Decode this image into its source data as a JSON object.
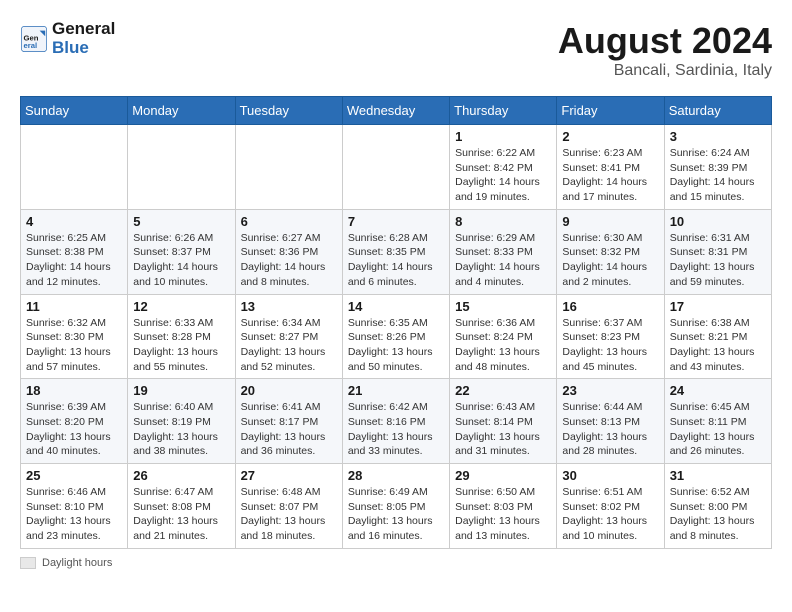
{
  "header": {
    "logo_line1": "General",
    "logo_line2": "Blue",
    "month_year": "August 2024",
    "location": "Bancali, Sardinia, Italy"
  },
  "legend": {
    "label": "Daylight hours"
  },
  "days_of_week": [
    "Sunday",
    "Monday",
    "Tuesday",
    "Wednesday",
    "Thursday",
    "Friday",
    "Saturday"
  ],
  "weeks": [
    [
      {
        "day": "",
        "info": ""
      },
      {
        "day": "",
        "info": ""
      },
      {
        "day": "",
        "info": ""
      },
      {
        "day": "",
        "info": ""
      },
      {
        "day": "1",
        "info": "Sunrise: 6:22 AM\nSunset: 8:42 PM\nDaylight: 14 hours and 19 minutes."
      },
      {
        "day": "2",
        "info": "Sunrise: 6:23 AM\nSunset: 8:41 PM\nDaylight: 14 hours and 17 minutes."
      },
      {
        "day": "3",
        "info": "Sunrise: 6:24 AM\nSunset: 8:39 PM\nDaylight: 14 hours and 15 minutes."
      }
    ],
    [
      {
        "day": "4",
        "info": "Sunrise: 6:25 AM\nSunset: 8:38 PM\nDaylight: 14 hours and 12 minutes."
      },
      {
        "day": "5",
        "info": "Sunrise: 6:26 AM\nSunset: 8:37 PM\nDaylight: 14 hours and 10 minutes."
      },
      {
        "day": "6",
        "info": "Sunrise: 6:27 AM\nSunset: 8:36 PM\nDaylight: 14 hours and 8 minutes."
      },
      {
        "day": "7",
        "info": "Sunrise: 6:28 AM\nSunset: 8:35 PM\nDaylight: 14 hours and 6 minutes."
      },
      {
        "day": "8",
        "info": "Sunrise: 6:29 AM\nSunset: 8:33 PM\nDaylight: 14 hours and 4 minutes."
      },
      {
        "day": "9",
        "info": "Sunrise: 6:30 AM\nSunset: 8:32 PM\nDaylight: 14 hours and 2 minutes."
      },
      {
        "day": "10",
        "info": "Sunrise: 6:31 AM\nSunset: 8:31 PM\nDaylight: 13 hours and 59 minutes."
      }
    ],
    [
      {
        "day": "11",
        "info": "Sunrise: 6:32 AM\nSunset: 8:30 PM\nDaylight: 13 hours and 57 minutes."
      },
      {
        "day": "12",
        "info": "Sunrise: 6:33 AM\nSunset: 8:28 PM\nDaylight: 13 hours and 55 minutes."
      },
      {
        "day": "13",
        "info": "Sunrise: 6:34 AM\nSunset: 8:27 PM\nDaylight: 13 hours and 52 minutes."
      },
      {
        "day": "14",
        "info": "Sunrise: 6:35 AM\nSunset: 8:26 PM\nDaylight: 13 hours and 50 minutes."
      },
      {
        "day": "15",
        "info": "Sunrise: 6:36 AM\nSunset: 8:24 PM\nDaylight: 13 hours and 48 minutes."
      },
      {
        "day": "16",
        "info": "Sunrise: 6:37 AM\nSunset: 8:23 PM\nDaylight: 13 hours and 45 minutes."
      },
      {
        "day": "17",
        "info": "Sunrise: 6:38 AM\nSunset: 8:21 PM\nDaylight: 13 hours and 43 minutes."
      }
    ],
    [
      {
        "day": "18",
        "info": "Sunrise: 6:39 AM\nSunset: 8:20 PM\nDaylight: 13 hours and 40 minutes."
      },
      {
        "day": "19",
        "info": "Sunrise: 6:40 AM\nSunset: 8:19 PM\nDaylight: 13 hours and 38 minutes."
      },
      {
        "day": "20",
        "info": "Sunrise: 6:41 AM\nSunset: 8:17 PM\nDaylight: 13 hours and 36 minutes."
      },
      {
        "day": "21",
        "info": "Sunrise: 6:42 AM\nSunset: 8:16 PM\nDaylight: 13 hours and 33 minutes."
      },
      {
        "day": "22",
        "info": "Sunrise: 6:43 AM\nSunset: 8:14 PM\nDaylight: 13 hours and 31 minutes."
      },
      {
        "day": "23",
        "info": "Sunrise: 6:44 AM\nSunset: 8:13 PM\nDaylight: 13 hours and 28 minutes."
      },
      {
        "day": "24",
        "info": "Sunrise: 6:45 AM\nSunset: 8:11 PM\nDaylight: 13 hours and 26 minutes."
      }
    ],
    [
      {
        "day": "25",
        "info": "Sunrise: 6:46 AM\nSunset: 8:10 PM\nDaylight: 13 hours and 23 minutes."
      },
      {
        "day": "26",
        "info": "Sunrise: 6:47 AM\nSunset: 8:08 PM\nDaylight: 13 hours and 21 minutes."
      },
      {
        "day": "27",
        "info": "Sunrise: 6:48 AM\nSunset: 8:07 PM\nDaylight: 13 hours and 18 minutes."
      },
      {
        "day": "28",
        "info": "Sunrise: 6:49 AM\nSunset: 8:05 PM\nDaylight: 13 hours and 16 minutes."
      },
      {
        "day": "29",
        "info": "Sunrise: 6:50 AM\nSunset: 8:03 PM\nDaylight: 13 hours and 13 minutes."
      },
      {
        "day": "30",
        "info": "Sunrise: 6:51 AM\nSunset: 8:02 PM\nDaylight: 13 hours and 10 minutes."
      },
      {
        "day": "31",
        "info": "Sunrise: 6:52 AM\nSunset: 8:00 PM\nDaylight: 13 hours and 8 minutes."
      }
    ]
  ]
}
